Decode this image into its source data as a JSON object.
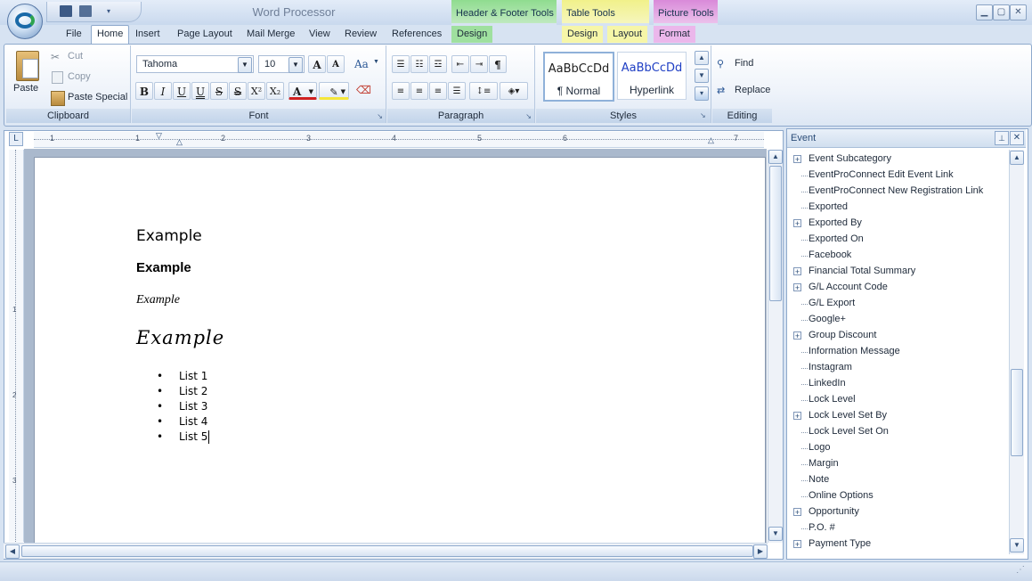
{
  "window": {
    "title": "Word Processor"
  },
  "contextual_tabs": [
    {
      "label": "Header & Footer Tools",
      "color": "#66cc66"
    },
    {
      "label": "Table Tools",
      "color": "#e8e870"
    },
    {
      "label": "Picture Tools",
      "color": "#cc66cc"
    }
  ],
  "tabs": {
    "file": "File",
    "home": "Home",
    "insert": "Insert",
    "page_layout": "Page Layout",
    "mail_merge": "Mail Merge",
    "view": "View",
    "review": "Review",
    "references": "References",
    "hf_design": "Design",
    "table_design": "Design",
    "table_layout": "Layout",
    "picture_format": "Format"
  },
  "clipboard": {
    "paste": "Paste",
    "cut": "Cut",
    "copy": "Copy",
    "paste_special": "Paste Special",
    "group": "Clipboard"
  },
  "font": {
    "name": "Tahoma",
    "size": "10",
    "change_case": "Aa",
    "group": "Font",
    "bold": "B",
    "italic": "I",
    "underline": "U",
    "double_underline": "U",
    "strike": "S",
    "double_strike": "S",
    "superscript": "X²",
    "subscript": "X₂",
    "font_color": "A"
  },
  "paragraph": {
    "group": "Paragraph",
    "show_marks": "¶"
  },
  "styles": {
    "group": "Styles",
    "normal_sample": "AaBbCcDd",
    "normal_name": "¶ Normal",
    "hyperlink_sample": "AaBbCcDd",
    "hyperlink_name": "Hyperlink"
  },
  "editing": {
    "find": "Find",
    "replace": "Replace",
    "group": "Editing"
  },
  "ruler": {
    "h_labels": [
      "1",
      "1",
      "2",
      "3",
      "4",
      "5",
      "6",
      "7"
    ],
    "v_labels": [
      "1",
      "2",
      "3"
    ]
  },
  "document": {
    "examples": [
      "Example",
      "Example",
      "Example",
      "Example"
    ],
    "list": [
      "List 1",
      "List 2",
      "List 3",
      "List 4",
      "List 5"
    ]
  },
  "pane": {
    "title": "Event",
    "items": [
      {
        "label": "Event Subcategory",
        "expandable": true
      },
      {
        "label": "EventProConnect Edit Event Link",
        "expandable": false
      },
      {
        "label": "EventProConnect New Registration Link",
        "expandable": false
      },
      {
        "label": "Exported",
        "expandable": false
      },
      {
        "label": "Exported By",
        "expandable": true
      },
      {
        "label": "Exported On",
        "expandable": false
      },
      {
        "label": "Facebook",
        "expandable": false
      },
      {
        "label": "Financial Total Summary",
        "expandable": true
      },
      {
        "label": "G/L Account Code",
        "expandable": true
      },
      {
        "label": "G/L Export",
        "expandable": false
      },
      {
        "label": "Google+",
        "expandable": false
      },
      {
        "label": "Group Discount",
        "expandable": true
      },
      {
        "label": "Information Message",
        "expandable": false
      },
      {
        "label": "Instagram",
        "expandable": false
      },
      {
        "label": "LinkedIn",
        "expandable": false
      },
      {
        "label": "Lock Level",
        "expandable": false
      },
      {
        "label": "Lock Level Set By",
        "expandable": true
      },
      {
        "label": "Lock Level Set On",
        "expandable": false
      },
      {
        "label": "Logo",
        "expandable": false
      },
      {
        "label": "Margin",
        "expandable": false
      },
      {
        "label": "Note",
        "expandable": false
      },
      {
        "label": "Online Options",
        "expandable": false
      },
      {
        "label": "Opportunity",
        "expandable": true
      },
      {
        "label": "P.O. #",
        "expandable": false
      },
      {
        "label": "Payment Type",
        "expandable": true
      }
    ]
  }
}
